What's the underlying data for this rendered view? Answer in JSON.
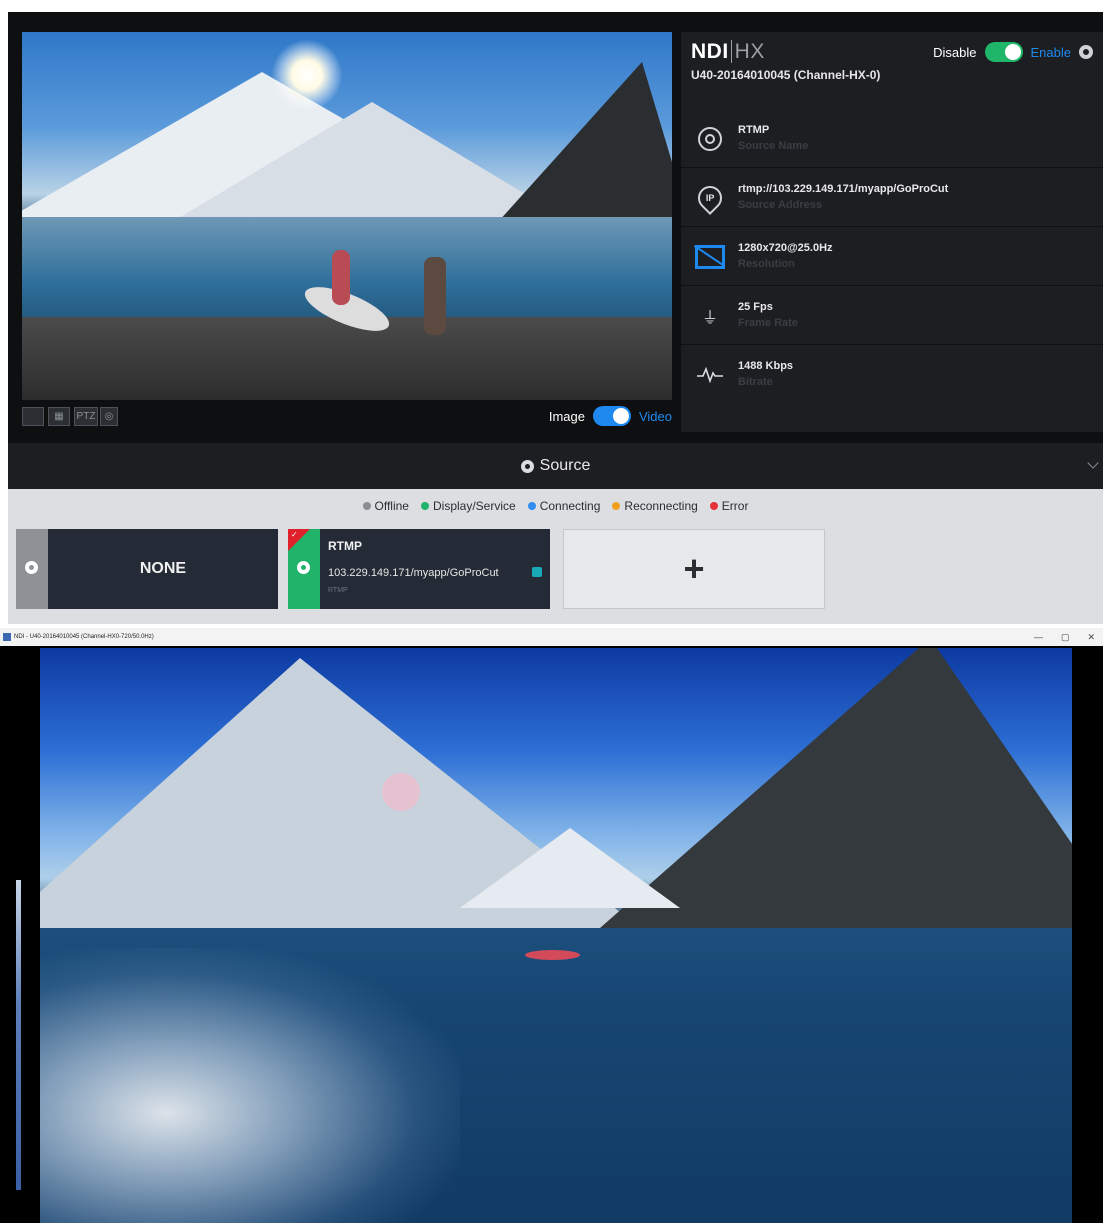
{
  "info_panel": {
    "logo_ndi": "NDI",
    "logo_hx": "HX",
    "device_name": "U40-20164010045 (Channel-HX-0)",
    "disable_label": "Disable",
    "enable_label": "Enable",
    "rows": [
      {
        "value": "RTMP",
        "label": "Source Name",
        "icon": "source-ring-icon"
      },
      {
        "value": "rtmp://103.229.149.171/myapp/GoProCut",
        "label": "Source Address",
        "icon": "ip-pin-icon"
      },
      {
        "value": "1280x720@25.0Hz",
        "label": "Resolution",
        "icon": "monitor-icon"
      },
      {
        "value": "25 Fps",
        "label": "Frame Rate",
        "icon": "camera-stand-icon"
      },
      {
        "value": "1488 Kbps",
        "label": "Bitrate",
        "icon": "pulse-icon"
      }
    ]
  },
  "preview_toolbar": {
    "ptz_label": "PTZ",
    "image_label": "Image",
    "video_label": "Video"
  },
  "source_bar": {
    "title": "Source"
  },
  "legend": [
    {
      "label": "Offline",
      "color": "#8a8d91"
    },
    {
      "label": "Display/Service",
      "color": "#21b36a"
    },
    {
      "label": "Connecting",
      "color": "#2f8ef0"
    },
    {
      "label": "Reconnecting",
      "color": "#f0a01e"
    },
    {
      "label": "Error",
      "color": "#e3323c"
    }
  ],
  "cards": {
    "none_label": "NONE",
    "rtmp_title": "RTMP",
    "rtmp_address": "103.229.149.171/myapp/GoProCut",
    "rtmp_sub": "RTMP",
    "add_label": "+"
  },
  "viewer": {
    "window_title": "NDI - U40-20164010045 (Channel-HX0-720/50.0Hz)",
    "min": "—",
    "max": "▢",
    "close": "✕"
  },
  "colors": {
    "accent_blue": "#1e8af0",
    "toggle_green": "#1fb66a",
    "panel_dark": "#1c1e21"
  }
}
